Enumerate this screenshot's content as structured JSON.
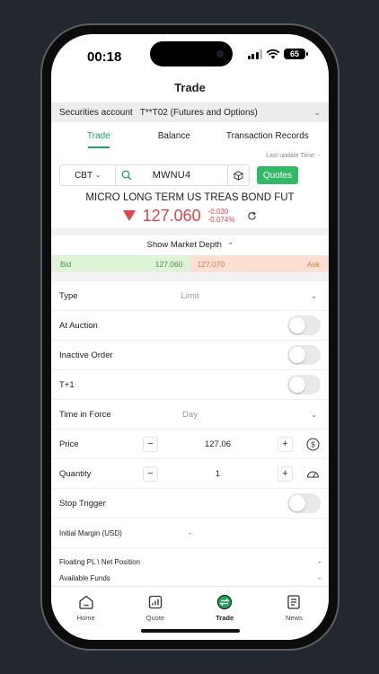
{
  "status_bar": {
    "time": "00:18",
    "battery": "65"
  },
  "page": {
    "title": "Trade"
  },
  "account": {
    "label": "Securities account",
    "value": "T**T02 (Futures and Options)"
  },
  "tabs": [
    {
      "label": "Trade",
      "active": true
    },
    {
      "label": "Balance",
      "active": false
    },
    {
      "label": "Transaction Records",
      "active": false
    }
  ],
  "last_update": "Last update Time: -",
  "search": {
    "exchange": "CBT",
    "symbol": "MWNU4",
    "quotes_label": "Quotes"
  },
  "instrument": {
    "name": "MICRO LONG TERM US TREAS BOND FUT",
    "price": "127.060",
    "change": "-0.030",
    "change_pct": "-0.074%",
    "price_color": "#e0454b"
  },
  "depth": {
    "toggle_label": "Show Market Depth",
    "bid_label": "Bid",
    "bid_price": "127.060",
    "ask_price": "127.070",
    "ask_label": "Ask"
  },
  "form": {
    "type_label": "Type",
    "type_value": "Limit",
    "at_auction": "At Auction",
    "inactive_order": "Inactive Order",
    "t_plus_1": "T+1",
    "tif_label": "Time in Force",
    "tif_value": "Day",
    "price_label": "Price",
    "price_value": "127.06",
    "quantity_label": "Quantity",
    "quantity_value": "1",
    "stop_trigger": "Stop Trigger",
    "margin_label": "Initial Margin (USD)",
    "margin_value": "-",
    "floating_label": "Floating PL \\ Net Position",
    "floating_value": "-",
    "funds_label": "Available Funds",
    "funds_value": "-"
  },
  "tabbar": [
    {
      "label": "Home",
      "icon": "home-icon"
    },
    {
      "label": "Quote",
      "icon": "quote-chart-icon"
    },
    {
      "label": "Trade",
      "icon": "trade-icon",
      "active": true
    },
    {
      "label": "News",
      "icon": "news-icon"
    }
  ],
  "colors": {
    "accent": "#1ea85a",
    "quotes_button": "#33b866",
    "bid_bg": "#dff3d9",
    "ask_bg": "#fbe0d3"
  }
}
